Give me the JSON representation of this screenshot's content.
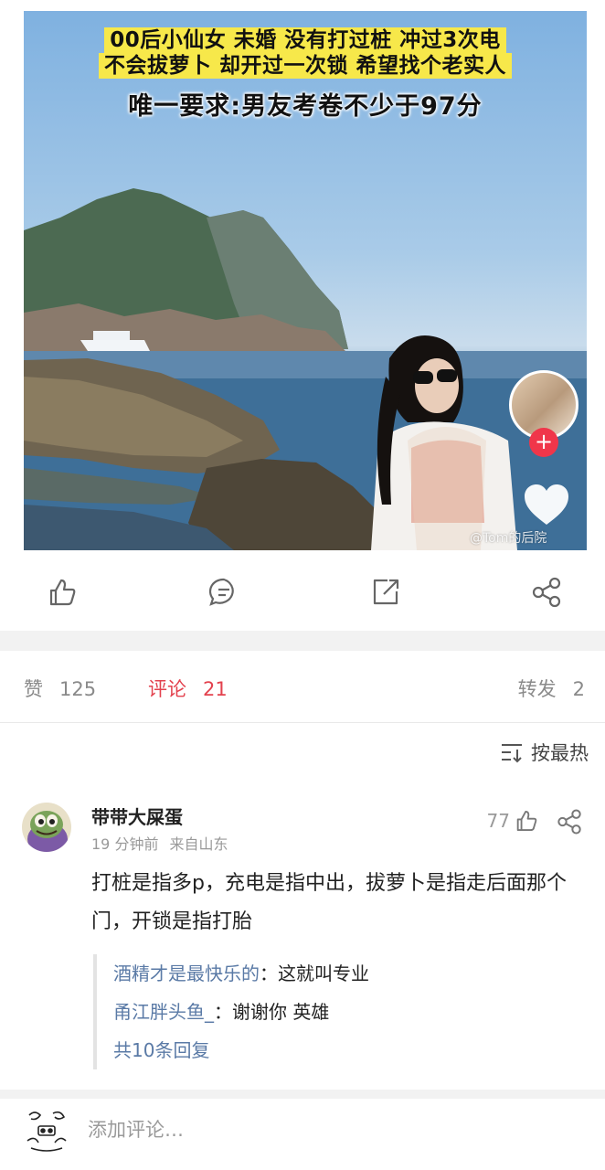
{
  "post": {
    "banner_line_1": "00后小仙女 未婚 没有打过桩 冲过3次电",
    "banner_line_2": "不会拔萝卜 却开过一次锁 希望找个老实人",
    "banner_line_3": "唯一要求:男友考卷不少于97分",
    "watermark": "@Tom的后院"
  },
  "stats": {
    "likes_label": "赞",
    "likes_count": "125",
    "comments_label": "评论",
    "comments_count": "21",
    "reposts_label": "转发",
    "reposts_count": "2"
  },
  "sort": {
    "label": "按最热"
  },
  "comment": {
    "username": "带带大屎蛋",
    "time": "19 分钟前",
    "source": "来自山东",
    "like_count": "77",
    "text": "打桩是指多p，充电是指中出，拔萝卜是指走后面那个门，开锁是指打胎",
    "replies": [
      {
        "user": "酒精才是最快乐的",
        "text": "：这就叫专业"
      },
      {
        "user": "甬江胖头鱼_",
        "text": "：谢谢你 英雄"
      }
    ],
    "more_replies": "共10条回复"
  },
  "bottom": {
    "placeholder": "添加评论…"
  },
  "colors": {
    "accent": "#e3424e",
    "link": "#5a7aa6",
    "banner": "#f7e84a"
  },
  "icons": [
    "like-icon",
    "comment-icon",
    "repost-icon",
    "share-icon",
    "sort-icon",
    "heart-icon",
    "plus-icon"
  ]
}
